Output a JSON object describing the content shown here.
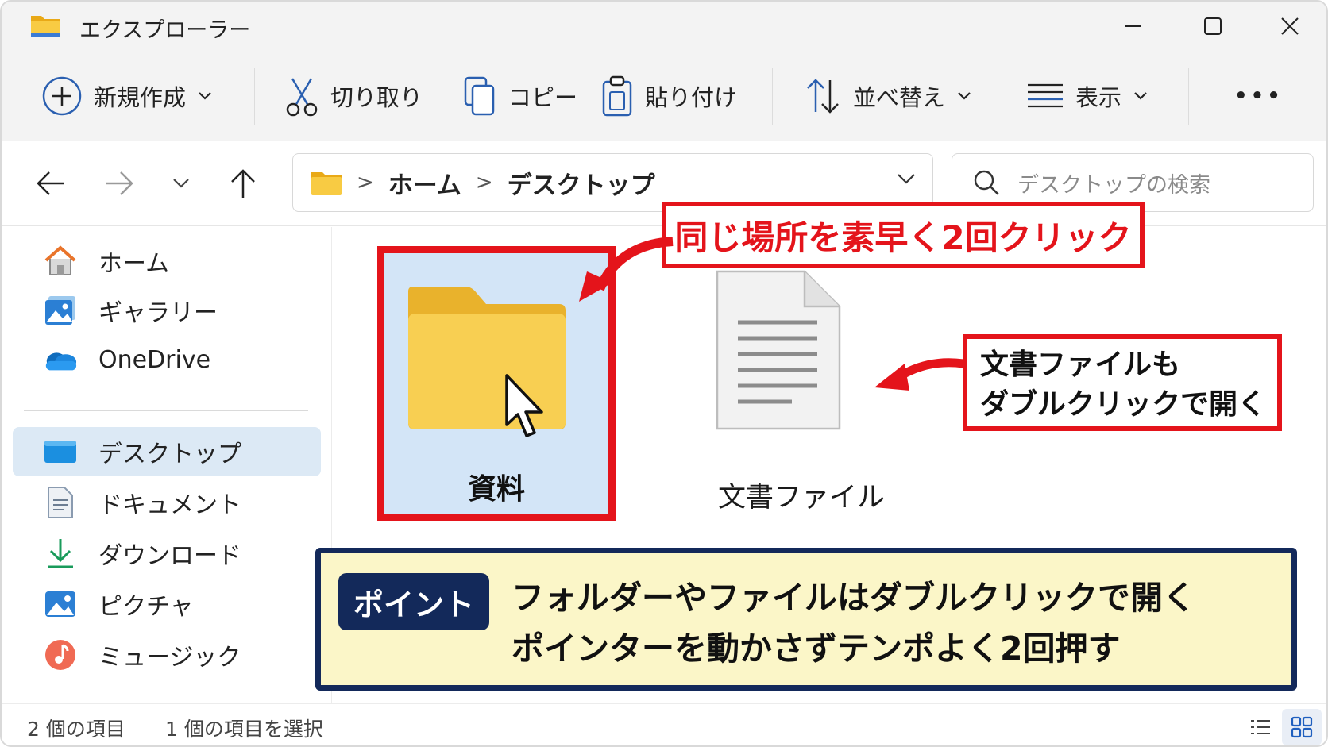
{
  "window": {
    "title": "エクスプローラー"
  },
  "toolbar": {
    "new_label": "新規作成",
    "cut_label": "切り取り",
    "copy_label": "コピー",
    "paste_label": "貼り付け",
    "sort_label": "並べ替え",
    "view_label": "表示",
    "more_label": "•••"
  },
  "address": {
    "crumbs": [
      "ホーム",
      "デスクトップ"
    ],
    "separator": ">"
  },
  "search": {
    "placeholder": "デスクトップの検索"
  },
  "sidebar": {
    "items": [
      {
        "label": "ホーム",
        "icon": "home-icon"
      },
      {
        "label": "ギャラリー",
        "icon": "gallery-icon"
      },
      {
        "label": "OneDrive",
        "icon": "onedrive-cloud-icon"
      },
      {
        "label": "デスクトップ",
        "icon": "desktop-icon",
        "selected": true
      },
      {
        "label": "ドキュメント",
        "icon": "documents-icon"
      },
      {
        "label": "ダウンロード",
        "icon": "downloads-icon"
      },
      {
        "label": "ピクチャ",
        "icon": "pictures-icon"
      },
      {
        "label": "ミュージック",
        "icon": "music-icon"
      }
    ]
  },
  "content": {
    "items": [
      {
        "name": "資料",
        "type": "folder",
        "selected": true
      },
      {
        "name": "文書ファイル",
        "type": "document"
      }
    ]
  },
  "annotations": {
    "callout_double_click": "同じ場所を素早く2回クリック",
    "callout_document_line1": "文書ファイルも",
    "callout_document_line2": "ダブルクリックで開く",
    "point_badge": "ポイント",
    "point_line1": "フォルダーやファイルはダブルクリックで開く",
    "point_line2": "ポインターを動かさずテンポよく2回押す"
  },
  "status": {
    "item_count": "2 個の項目",
    "selected_count": "1 個の項目を選択"
  },
  "colors": {
    "accent_red": "#e4141b",
    "navy": "#13295a",
    "point_bg": "#fbf6c8",
    "selection_bg": "#d3e5f7",
    "folder_yellow": "#f6c945"
  }
}
